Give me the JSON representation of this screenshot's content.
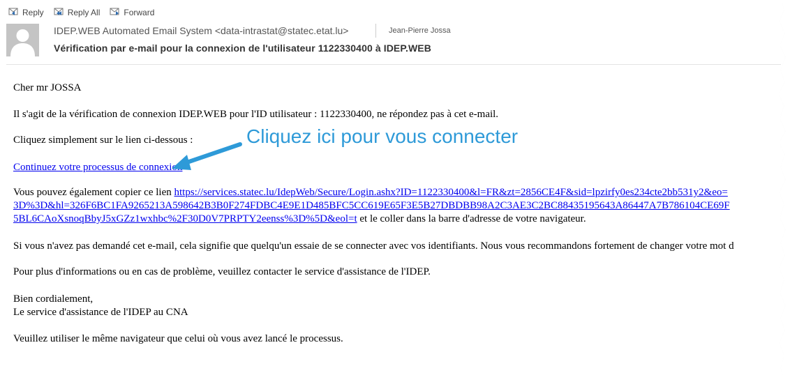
{
  "toolbar": {
    "reply": "Reply",
    "reply_all": "Reply All",
    "forward": "Forward"
  },
  "header": {
    "from": "IDEP.WEB Automated Email System <data-intrastat@statec.etat.lu>",
    "to": "Jean-Pierre Jossa",
    "subject": "Vérification par e-mail pour la connexion de l'utilisateur 1122330400 à IDEP.WEB"
  },
  "body": {
    "greeting": "Cher mr JOSSA",
    "verification": "Il s'agit de la vérification de connexion IDEP.WEB pour l'ID utilisateur : 1122330400, ne répondez pas à cet e-mail.",
    "click_intro": "Cliquez simplement sur le lien ci-dessous :",
    "link_label": "Continuez votre processus de connexion",
    "copy_prefix": "Vous pouvez également copier ce lien ",
    "url_line1": "https://services.statec.lu/IdepWeb/Secure/Login.ashx?ID=1122330400&l=FR&zt=2856CE4F&sid=lpzirfy0es234cte2bb531y2&eo=",
    "url_line2": "3D%3D&hl=326F6BC1FA9265213A598642B3B0F274FDBC4E9E1D485BFC5CC619E65F3E5B27DBDBB98A2C3AE3C2BC88435195643A86447A7B786104CE69F",
    "url_line3": "5BL6CAoXsnoqBbyJ5xGZz1wxhbc%2F30D0V7PRPTY2eenss%3D%5D&eol=t",
    "copy_suffix": " et le coller dans la barre d'adresse de votre navigateur.",
    "warning": "Si vous n'avez pas demandé cet e-mail, cela signifie que quelqu'un essaie de se connecter avec vos identifiants. Nous vous recommandons fortement de changer votre mot d",
    "support": "Pour plus d'informations ou en cas de problème, veuillez contacter le service d'assistance de l'IDEP.",
    "closing": "Bien cordialement,",
    "signature": "Le service d'assistance de l'IDEP au CNA",
    "browser_note": "Veuillez utiliser le même navigateur que celui où vous avez lancé le processus."
  },
  "annotation": {
    "text": "Cliquez ici pour vous connecter",
    "color": "#2e9ad8"
  }
}
